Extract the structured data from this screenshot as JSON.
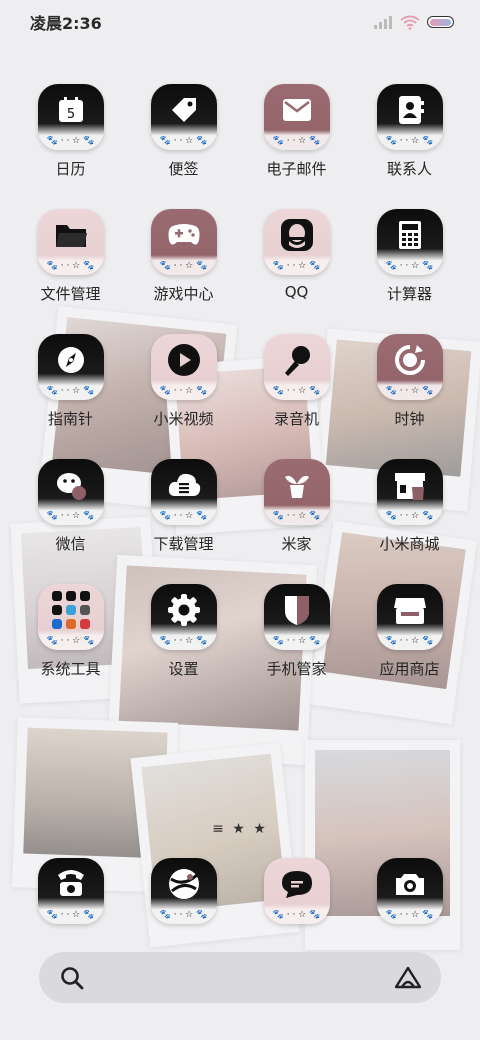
{
  "status_bar": {
    "time": "凌晨2:36",
    "signal_icon": "signal-icon",
    "wifi_icon": "wifi-icon",
    "battery_icon": "battery-icon"
  },
  "theme": {
    "black": "#111111",
    "rose": "#966870",
    "pink": "#ead3d5"
  },
  "apps": [
    {
      "label": "日历",
      "icon": "calendar-icon",
      "style": "black",
      "badge": "5"
    },
    {
      "label": "便签",
      "icon": "tag-icon",
      "style": "black"
    },
    {
      "label": "电子邮件",
      "icon": "mail-icon",
      "style": "rose"
    },
    {
      "label": "联系人",
      "icon": "contacts-icon",
      "style": "black"
    },
    {
      "label": "文件管理",
      "icon": "folder-icon",
      "style": "pink"
    },
    {
      "label": "游戏中心",
      "icon": "gamepad-icon",
      "style": "rose"
    },
    {
      "label": "QQ",
      "icon": "qq-icon",
      "style": "pink"
    },
    {
      "label": "计算器",
      "icon": "calculator-icon",
      "style": "black"
    },
    {
      "label": "指南针",
      "icon": "compass-icon",
      "style": "black"
    },
    {
      "label": "小米视频",
      "icon": "play-icon",
      "style": "pink"
    },
    {
      "label": "录音机",
      "icon": "microphone-icon",
      "style": "pink"
    },
    {
      "label": "时钟",
      "icon": "clock-icon",
      "style": "rose"
    },
    {
      "label": "微信",
      "icon": "wechat-icon",
      "style": "black"
    },
    {
      "label": "下载管理",
      "icon": "download-icon",
      "style": "black"
    },
    {
      "label": "米家",
      "icon": "plant-icon",
      "style": "rose"
    },
    {
      "label": "小米商城",
      "icon": "shop-icon",
      "style": "black"
    },
    {
      "label": "系统工具",
      "icon": "folder-grid-icon",
      "style": "pink"
    },
    {
      "label": "设置",
      "icon": "gear-icon",
      "style": "black"
    },
    {
      "label": "手机管家",
      "icon": "shield-icon",
      "style": "black"
    },
    {
      "label": "应用商店",
      "icon": "store-icon",
      "style": "black"
    }
  ],
  "page_indicator": "≡ ★ ★",
  "dock": [
    {
      "icon": "phone-icon",
      "style": "black"
    },
    {
      "icon": "browser-icon",
      "style": "black"
    },
    {
      "icon": "message-icon",
      "style": "pink"
    },
    {
      "icon": "camera-icon",
      "style": "black"
    }
  ],
  "search": {
    "search_icon": "search-icon",
    "assistant_icon": "assistant-icon"
  }
}
